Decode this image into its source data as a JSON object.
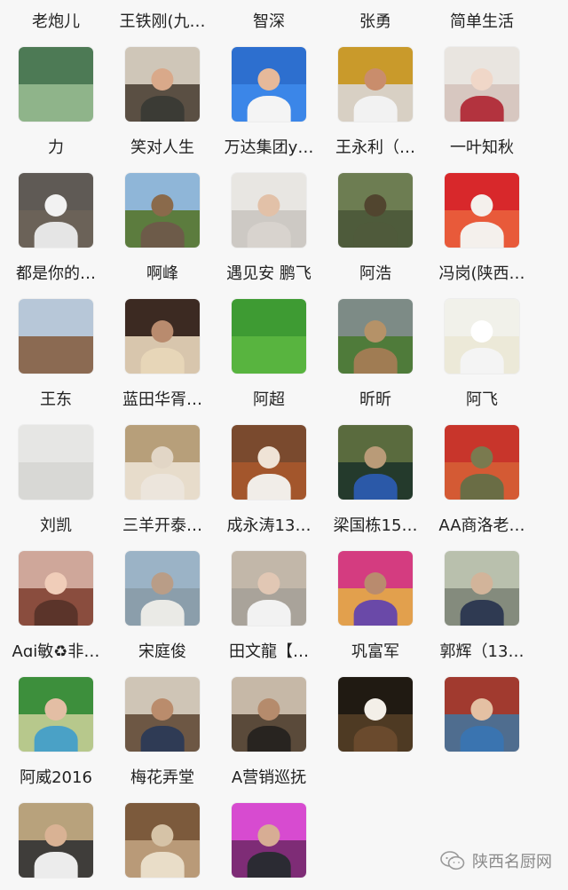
{
  "contacts": [
    {
      "name": "老炮儿",
      "c1": "#4d7a55",
      "c2": "#8fb48a",
      "head": null,
      "body": null
    },
    {
      "name": "王铁刚(九…",
      "c1": "#cfc6b8",
      "c2": "#5a4f43",
      "head": "#d9a98a",
      "body": "#3b3b35"
    },
    {
      "name": "智深",
      "c1": "#2d6fcf",
      "c2": "#3b86e8",
      "head": "#e6b99a",
      "body": "#f4f4f4"
    },
    {
      "name": "张勇",
      "c1": "#c99a2b",
      "c2": "#d8d0c4",
      "head": "#c98d6c",
      "body": "#f2f2f2"
    },
    {
      "name": "简单生活",
      "c1": "#e9e5e0",
      "c2": "#d7c7c0",
      "head": "#f0d7c8",
      "body": "#b3333e"
    },
    {
      "name": "力",
      "c1": "#5f5a55",
      "c2": "#6b6258",
      "head": "#f2f2f2",
      "body": "#e5e5e5"
    },
    {
      "name": "笑对人生",
      "c1": "#8fb6d8",
      "c2": "#5c7c3e",
      "head": "#8a6a4b",
      "body": "#6d5b49"
    },
    {
      "name": "万达集团y…",
      "c1": "#e8e6e2",
      "c2": "#cdc9c4",
      "head": "#e2c1a8",
      "body": "#d8d3ce"
    },
    {
      "name": "王永利（…",
      "c1": "#6d7d52",
      "c2": "#4e5b3b",
      "head": "#51452f",
      "body": "#4f5a3b"
    },
    {
      "name": "一叶知秋",
      "c1": "#d8282b",
      "c2": "#e85a3a",
      "head": "#f4f0ec",
      "body": "#f4f0ec"
    },
    {
      "name": "都是你的…",
      "c1": "#b7c7d8",
      "c2": "#8b6a52",
      "head": null,
      "body": null
    },
    {
      "name": "啊峰",
      "c1": "#3c2a22",
      "c2": "#d8c6ad",
      "head": "#b98b6e",
      "body": "#e7d6b8"
    },
    {
      "name": "遇见安 鹏飞",
      "c1": "#3e9b33",
      "c2": "#58b43f",
      "head": null,
      "body": null
    },
    {
      "name": "阿浩",
      "c1": "#7d8b86",
      "c2": "#4f7b3a",
      "head": "#b59268",
      "body": "#a07c53"
    },
    {
      "name": "冯岗(陕西…",
      "c1": "#f1f1ea",
      "c2": "#ece9d8",
      "head": "#ffffff",
      "body": "#f4f4f4"
    },
    {
      "name": "王东",
      "c1": "#e6e6e4",
      "c2": "#d8d8d5",
      "head": null,
      "body": null
    },
    {
      "name": "蓝田华胥…",
      "c1": "#b79f7a",
      "c2": "#e7dccb",
      "head": "#e2d6c6",
      "body": "#ece5dc"
    },
    {
      "name": "阿超",
      "c1": "#7a4a2e",
      "c2": "#a3562c",
      "head": "#efe3d6",
      "body": "#f1ede8"
    },
    {
      "name": "昕昕",
      "c1": "#5a6b3e",
      "c2": "#243a2c",
      "head": "#b99b78",
      "body": "#2b59a8"
    },
    {
      "name": "阿飞",
      "c1": "#c8352b",
      "c2": "#d45a34",
      "head": "#7a7a4f",
      "body": "#6a6d45"
    },
    {
      "name": "刘凯",
      "c1": "#cfa79a",
      "c2": "#8a4d3e",
      "head": "#f0cdb9",
      "body": "#5b342a"
    },
    {
      "name": "三羊开泰…",
      "c1": "#9bb3c6",
      "c2": "#8b9eab",
      "head": "#b99d87",
      "body": "#eaeae6"
    },
    {
      "name": "成永涛13…",
      "c1": "#c2b7a9",
      "c2": "#a9a39a",
      "head": "#e1c7b4",
      "body": "#f2f2f2"
    },
    {
      "name": "梁国栋15…",
      "c1": "#d43c80",
      "c2": "#e2a04d",
      "head": "#b98b6e",
      "body": "#6a49a8"
    },
    {
      "name": "AA商洛老…",
      "c1": "#b9c0ad",
      "c2": "#848b7d",
      "head": "#d2b49a",
      "body": "#2f3a52"
    },
    {
      "name": "Aɑi敏♻非…",
      "c1": "#3d8f3c",
      "c2": "#b7c88c",
      "head": "#e3bea4",
      "body": "#4aa1c6"
    },
    {
      "name": "宋庭俊",
      "c1": "#cfc5b6",
      "c2": "#6d5744",
      "head": "#ba8c6c",
      "body": "#2f3b55"
    },
    {
      "name": "田文龍【…",
      "c1": "#c6b8a7",
      "c2": "#5a4a3a",
      "head": "#b58b6c",
      "body": "#282420"
    },
    {
      "name": "巩富军",
      "c1": "#201a12",
      "c2": "#4e3a23",
      "head": "#f3efe8",
      "body": "#6a4a2d"
    },
    {
      "name": "郭辉（13…",
      "c1": "#a13a2f",
      "c2": "#4f6d8f",
      "head": "#e4c0a3",
      "body": "#3a74b0"
    },
    {
      "name": "阿威2016",
      "c1": "#b8a27c",
      "c2": "#3f3d3a",
      "head": "#d9b294",
      "body": "#ececec"
    },
    {
      "name": "梅花弄堂",
      "c1": "#7c5a3c",
      "c2": "#b99a78",
      "head": "#d6c3a7",
      "body": "#e9ddc8"
    },
    {
      "name": "A营销巡抚",
      "c1": "#d74bd0",
      "c2": "#7e2c76",
      "head": "#d7ad94",
      "body": "#2b2b33"
    }
  ],
  "watermark": {
    "text": "陕西名厨网",
    "icon": "wechat-icon"
  }
}
